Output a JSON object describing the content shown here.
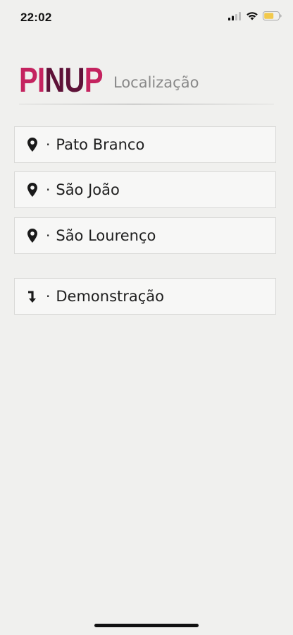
{
  "status_bar": {
    "time": "22:02",
    "icons": [
      "signal-icon",
      "wifi-icon",
      "battery-icon"
    ],
    "battery_color": "#f2c94c"
  },
  "header": {
    "logo_parts": [
      "PI",
      "NU",
      "P"
    ],
    "logo_colors": [
      "#c4235f",
      "#5e1238"
    ],
    "title": "Localização"
  },
  "locations": [
    {
      "icon": "map-pin-icon",
      "separator": "·",
      "label": "Pato Branco"
    },
    {
      "icon": "map-pin-icon",
      "separator": "·",
      "label": "São João"
    },
    {
      "icon": "map-pin-icon",
      "separator": "·",
      "label": "São Lourenço"
    },
    {
      "icon": "arrow-down-icon",
      "separator": "·",
      "label": "Demonstração"
    }
  ]
}
